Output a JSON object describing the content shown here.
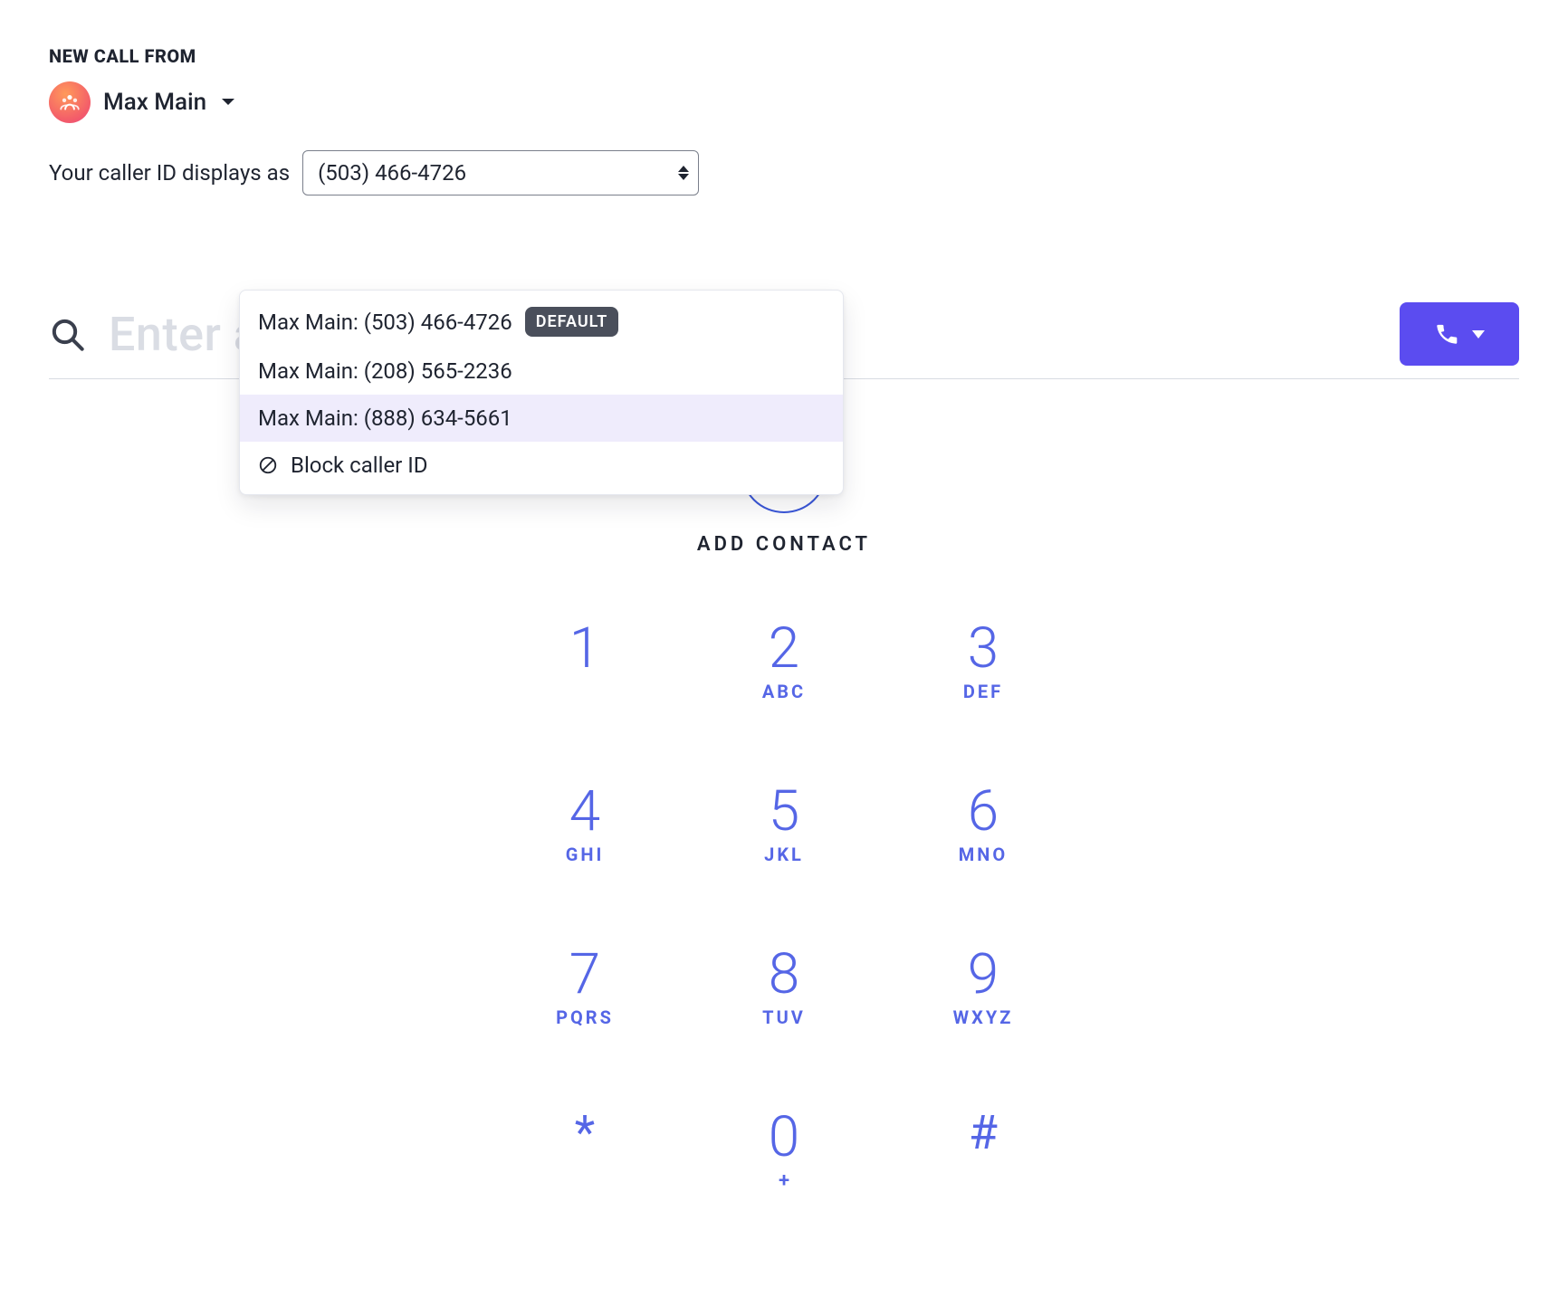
{
  "header": {
    "label": "NEW CALL FROM",
    "caller_name": "Max Main"
  },
  "caller_id": {
    "label": "Your caller ID displays as",
    "selected_value": "(503) 466-4726",
    "default_badge": "DEFAULT",
    "options": [
      {
        "label": "Max Main: (503) 466-4726",
        "is_default": true
      },
      {
        "label": "Max Main: (208) 565-2236",
        "is_default": false
      },
      {
        "label": "Max Main: (888) 634-5661",
        "is_default": false
      }
    ],
    "block_label": "Block caller ID",
    "highlighted_index": 2
  },
  "search": {
    "placeholder": "Enter a name or number"
  },
  "add_contact": {
    "label": "ADD CONTACT"
  },
  "dialpad": {
    "keys": [
      {
        "digit": "1",
        "letters": ""
      },
      {
        "digit": "2",
        "letters": "ABC"
      },
      {
        "digit": "3",
        "letters": "DEF"
      },
      {
        "digit": "4",
        "letters": "GHI"
      },
      {
        "digit": "5",
        "letters": "JKL"
      },
      {
        "digit": "6",
        "letters": "MNO"
      },
      {
        "digit": "7",
        "letters": "PQRS"
      },
      {
        "digit": "8",
        "letters": "TUV"
      },
      {
        "digit": "9",
        "letters": "WXYZ"
      },
      {
        "digit": "*",
        "letters": ""
      },
      {
        "digit": "0",
        "letters": "+"
      },
      {
        "digit": "#",
        "letters": ""
      }
    ]
  }
}
